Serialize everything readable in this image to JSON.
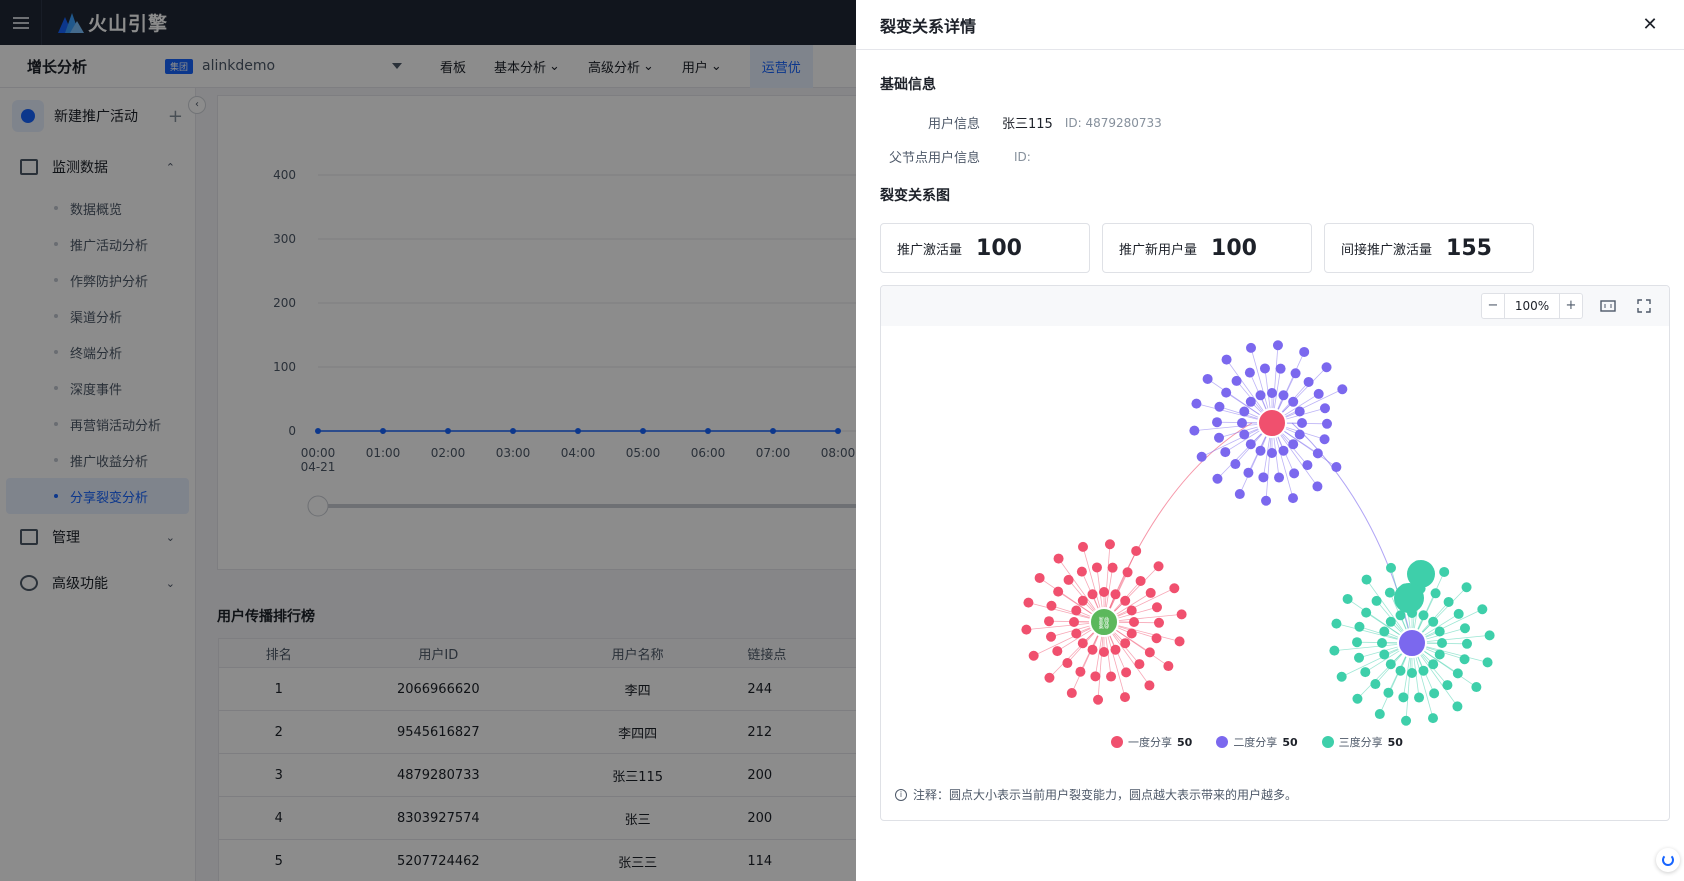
{
  "topbar": {
    "logo_text": "火山引擎"
  },
  "subnav": {
    "app_name": "增长分析",
    "badge": "集团",
    "project": "alinkdemo",
    "items": [
      "看板",
      "基本分析",
      "高级分析",
      "用户",
      "运营优"
    ]
  },
  "sidebar": {
    "new_activity": "新建推广活动",
    "monitor_group": "监测数据",
    "monitor_items": [
      "数据概览",
      "推广活动分析",
      "作弊防护分析",
      "渠道分析",
      "终端分析",
      "深度事件",
      "再营销活动分析",
      "推广收益分析",
      "分享裂变分析"
    ],
    "manage_group": "管理",
    "advanced_group": "高级功能"
  },
  "background_chart": {
    "y_ticks": [
      "400",
      "300",
      "200",
      "100",
      "0"
    ],
    "x_ticks": [
      "00:00",
      "01:00",
      "02:00",
      "03:00",
      "04:00",
      "05:00",
      "06:00",
      "07:00",
      "08:00"
    ],
    "x_date": "04-21",
    "values": [
      0,
      0,
      0,
      0,
      0,
      0,
      0,
      0,
      0
    ],
    "ymax": 400
  },
  "ranking": {
    "title": "用户传播排行榜",
    "headers": [
      "排名",
      "用户ID",
      "用户名称",
      "链接点"
    ],
    "rows": [
      [
        "1",
        "2066966620",
        "李四",
        "244"
      ],
      [
        "2",
        "9545616827",
        "李四四",
        "212"
      ],
      [
        "3",
        "4879280733",
        "张三115",
        "200"
      ],
      [
        "4",
        "8303927574",
        "张三",
        "200"
      ],
      [
        "5",
        "5207724462",
        "张三三",
        "114"
      ]
    ]
  },
  "drawer": {
    "title": "裂变关系详情",
    "basic_title": "基础信息",
    "user_info_label": "用户信息",
    "user_name": "张三115",
    "user_id": "ID: 4879280733",
    "parent_label": "父节点用户信息",
    "parent_id": "ID:",
    "graph_title": "裂变关系图",
    "stats": [
      {
        "label": "推广激活量",
        "value": "100"
      },
      {
        "label": "推广新用户量",
        "value": "100"
      },
      {
        "label": "间接推广激活量",
        "value": "155"
      }
    ],
    "zoom": "100%",
    "zoom_out": "−",
    "zoom_in": "+",
    "legend": [
      {
        "label": "一度分享",
        "count": "50",
        "color": "#f0506e"
      },
      {
        "label": "二度分享",
        "count": "50",
        "color": "#7b68ee"
      },
      {
        "label": "三度分享",
        "count": "50",
        "color": "#3ecfaa"
      }
    ],
    "note": "注释：圆点大小表示当前用户裂变能力，圆点越大表示带来的用户越多。"
  }
}
